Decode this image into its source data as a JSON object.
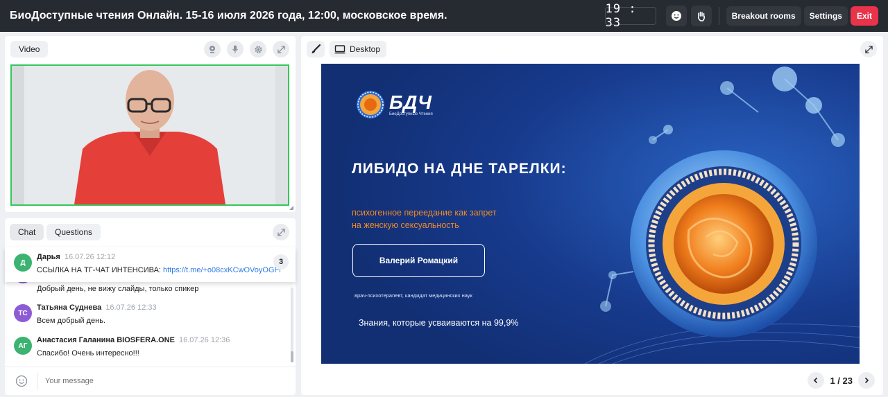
{
  "header": {
    "title": "БиоДоступные чтения Онлайн. 15-16 июля 2026 года, 12:00, московское время.",
    "timer": "19 : 33",
    "breakout_label": "Breakout rooms",
    "settings_label": "Settings",
    "exit_label": "Exit"
  },
  "video": {
    "tab_label": "Video"
  },
  "chat": {
    "tab_chat": "Chat",
    "tab_questions": "Questions",
    "pinned": {
      "initials": "Д",
      "author": "Дарья",
      "time": "16.07.26 12:12",
      "text": "ССЫЛКА НА ТГ-ЧАТ ИНТЕНСИВА: ",
      "link": "https://t.me/+o08cxKCwOVoyOGFl",
      "count": "3"
    },
    "messages": [
      {
        "initials": "",
        "author": "",
        "time": "",
        "text": "Добрый день, не вижу слайды, только спикер"
      },
      {
        "initials": "ТС",
        "author": "Татьяна Суднева",
        "time": "16.07.26 12:33",
        "text": "Всем добрый день."
      },
      {
        "initials": "АГ",
        "author": "Анастасия Галанина BIOSFERA.ONE",
        "time": "16.07.26 12:36",
        "text": "Спасибо! Очень интересно!!!"
      }
    ],
    "input_placeholder": "Your message"
  },
  "screen": {
    "source_label": "Desktop",
    "page_indicator": "1 / 23"
  },
  "slide": {
    "logo_text": "БДЧ",
    "logo_sub": "БиоДоступные Чтения",
    "title": "ЛИБИДО НА ДНЕ ТАРЕЛКИ:",
    "subtitle_line1": "психогенное переедание как запрет",
    "subtitle_line2": "на женскую сексуальность",
    "speaker_name": "Валерий Ромацкий",
    "speaker_title": "врач-психотерапевт, кандидат медицинских наук",
    "tagline": "Знания, которые усваиваются на 99,9%"
  },
  "colors": {
    "topbar": "#262a31",
    "exit": "#e8334a",
    "video_border": "#34c759",
    "slide_bg": "#173a8c",
    "slide_accent": "#f08a24",
    "avatar_green": "#3cb371",
    "avatar_purple": "#8e5bd6",
    "link": "#2f7be5"
  }
}
